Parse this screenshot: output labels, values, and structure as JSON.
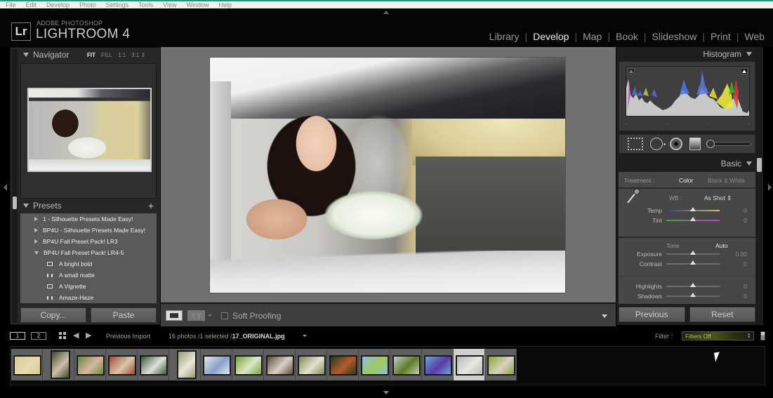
{
  "menubar": {
    "items": [
      "File",
      "Edit",
      "Develop",
      "Photo",
      "Settings",
      "Tools",
      "View",
      "Window",
      "Help"
    ]
  },
  "app": {
    "logo_letters": "Lr",
    "brand_sub": "ADOBE PHOTOSHOP",
    "brand_main": "LIGHTROOM 4"
  },
  "modules": {
    "items": [
      {
        "label": "Library",
        "active": false
      },
      {
        "label": "Develop",
        "active": true
      },
      {
        "label": "Map",
        "active": false
      },
      {
        "label": "Book",
        "active": false
      },
      {
        "label": "Slideshow",
        "active": false
      },
      {
        "label": "Print",
        "active": false
      },
      {
        "label": "Web",
        "active": false
      }
    ]
  },
  "navigator": {
    "title": "Navigator",
    "zoom_options": [
      "FIT",
      "FILL",
      "1:1",
      "3:1 ⇕"
    ],
    "active_zoom": "FIT"
  },
  "presets": {
    "title": "Presets",
    "add_icon": "+",
    "folders": [
      {
        "label": "1 - Silhouette Presets Made Easy!",
        "expanded": false
      },
      {
        "label": "BP4U - Silhouette Presets Made Easy!",
        "expanded": false
      },
      {
        "label": "BP4U Fall Preset Pack! LR3",
        "expanded": false
      },
      {
        "label": "BP4U Fall Preset Pack! LR4-5",
        "expanded": true
      }
    ],
    "items": [
      {
        "label": "A bright bold",
        "icon": "preset-box-icon"
      },
      {
        "label": "A small matte",
        "icon": "preset-hh-icon"
      },
      {
        "label": "A Vignette",
        "icon": "preset-box-icon"
      },
      {
        "label": "Amaze-Haze",
        "icon": "preset-hh-icon"
      }
    ]
  },
  "left_buttons": {
    "copy": "Copy...",
    "paste": "Paste"
  },
  "toolbar": {
    "yy_label": "Y Y",
    "soft_proofing": "Soft Proofing",
    "soft_proofing_checked": false
  },
  "histogram": {
    "title": "Histogram"
  },
  "basic": {
    "title": "Basic",
    "treatment_label": "Treatment :",
    "treatment_color": "Color",
    "treatment_bw": "Black & White",
    "wb_label": "WB :",
    "wb_value": "As Shot ⇕",
    "tone_label": "Tone",
    "auto_label": "Auto",
    "sliders": [
      {
        "label": "Temp",
        "value": "0",
        "position": 0.5
      },
      {
        "label": "Tint",
        "value": "0",
        "position": 0.5
      },
      {
        "label": "Exposure",
        "value": "0.00",
        "position": 0.5
      },
      {
        "label": "Contrast",
        "value": "0",
        "position": 0.5
      },
      {
        "label": "Highlights",
        "value": "0",
        "position": 0.5
      },
      {
        "label": "Shadows",
        "value": "0",
        "position": 0.5
      }
    ]
  },
  "right_buttons": {
    "previous": "Previous",
    "reset": "Reset"
  },
  "filmbar": {
    "screen1": "1",
    "screen2": "2",
    "source": "Previous Import",
    "count_text": "16 photos /1 selected /",
    "filename": "17_ORIGINAL.jpg",
    "filter_label": "Filter :",
    "filter_value": "Filters Off"
  },
  "filmstrip": {
    "total": 16,
    "selected_index": 14,
    "thumbs": [
      {
        "orient": "land",
        "colors": [
          "#d6c98a",
          "#e6dcb2"
        ]
      },
      {
        "orient": "port",
        "colors": [
          "#3e4a2a",
          "#cdbfa8"
        ]
      },
      {
        "orient": "land",
        "colors": [
          "#6a8a3a",
          "#d6b6a0"
        ]
      },
      {
        "orient": "land",
        "colors": [
          "#a04a3a",
          "#d8c7a8"
        ]
      },
      {
        "orient": "land",
        "colors": [
          "#3a5a3a",
          "#e0e0dc"
        ]
      },
      {
        "orient": "port",
        "colors": [
          "#9a9a72",
          "#e9e6dc"
        ]
      },
      {
        "orient": "land",
        "colors": [
          "#dfe6f0",
          "#8aa2c8"
        ]
      },
      {
        "orient": "land",
        "colors": [
          "#7aa23a",
          "#dbe7c8"
        ]
      },
      {
        "orient": "land",
        "colors": [
          "#5a4a3a",
          "#d8d2c6"
        ]
      },
      {
        "orient": "land",
        "colors": [
          "#7a8a5a",
          "#e6e2d2"
        ]
      },
      {
        "orient": "land",
        "colors": [
          "#2a3a1a",
          "#b45a2a"
        ]
      },
      {
        "orient": "land",
        "colors": [
          "#8fbde0",
          "#9ccb5a"
        ]
      },
      {
        "orient": "land",
        "colors": [
          "#c6cfb8",
          "#5e7a2a"
        ]
      },
      {
        "orient": "land",
        "colors": [
          "#6aa8d8",
          "#5a3aa8"
        ]
      },
      {
        "orient": "land",
        "colors": [
          "#b8b8b8",
          "#e8e8e0"
        ]
      },
      {
        "orient": "land",
        "colors": [
          "#8aa83a",
          "#d8d0c0"
        ]
      }
    ]
  },
  "colors": {
    "accent_teal": "#1a9a7a",
    "filter_text": "#b7c860"
  }
}
